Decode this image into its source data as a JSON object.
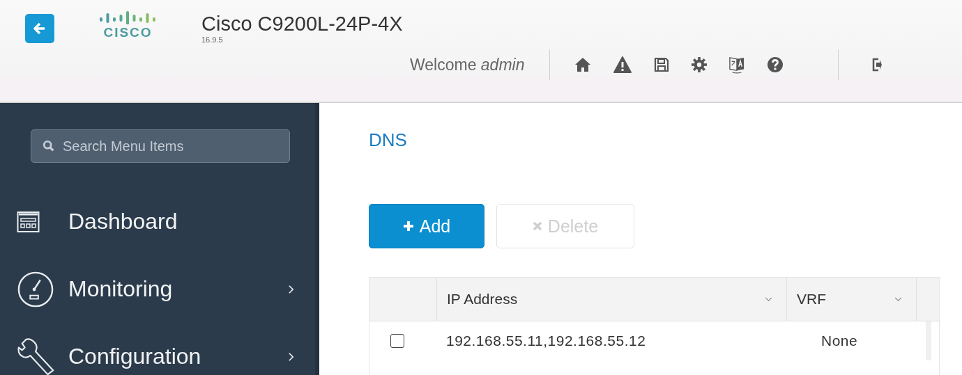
{
  "header": {
    "logo_text": "CISCO",
    "title": "Cisco C9200L-24P-4X",
    "version": "16.9.5",
    "welcome": "Welcome *admin*"
  },
  "sidebar": {
    "search": {
      "placeholder": "Search Menu Items"
    },
    "items": [
      {
        "label": "Dashboard",
        "kind": "dashboard",
        "has_submenu": false
      },
      {
        "label": "Monitoring",
        "kind": "monitoring",
        "has_submenu": true
      },
      {
        "label": "Configuration",
        "kind": "configuration",
        "has_submenu": true
      }
    ]
  },
  "page": {
    "title": "DNS",
    "buttons": [
      {
        "label": "Add",
        "kind": "add",
        "disabled": false
      },
      {
        "label": "Delete",
        "kind": "delete",
        "disabled": true
      }
    ],
    "table": {
      "columns": [
        "IP Address",
        "VRF"
      ],
      "rows": [
        {
          "checked": false,
          "cells": [
            "192.168.55.11,192.168.55.12",
            "None"
          ]
        }
      ]
    }
  }
}
